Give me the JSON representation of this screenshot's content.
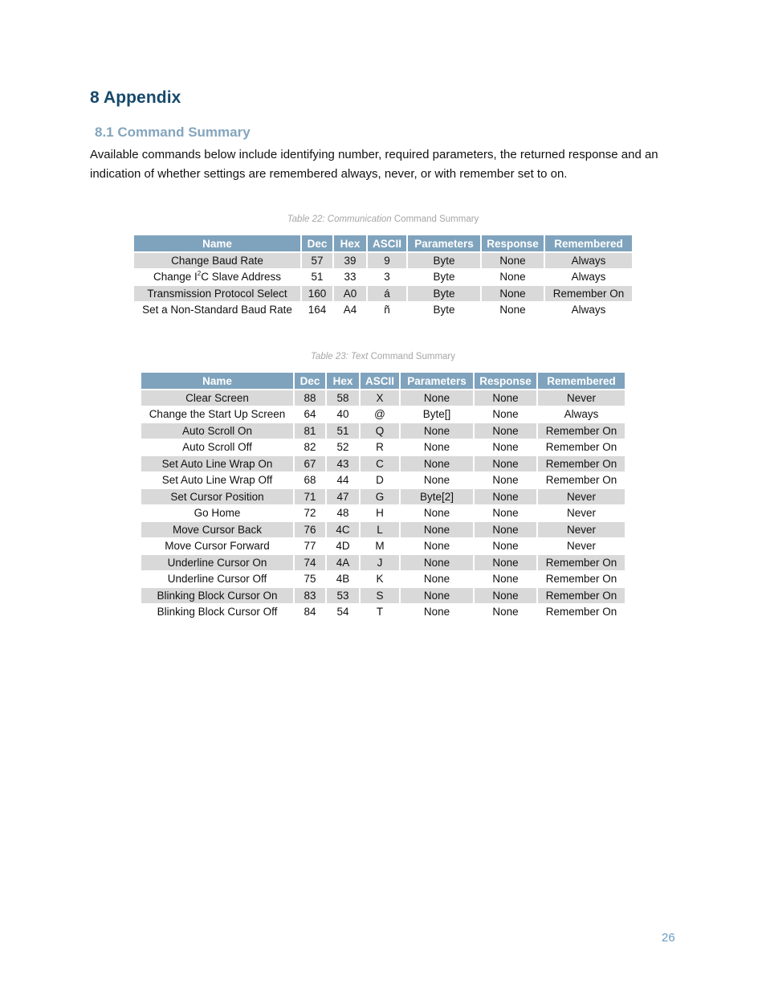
{
  "heading": "8 Appendix",
  "subheading": "8.1 Command Summary",
  "intro": "Available commands below include identifying number, required parameters, the returned response and an indication of whether settings are remembered always, never, or with remember set to on.",
  "colors": {
    "heading": "#17496a",
    "subheading": "#84a5bd",
    "table_header_bg": "#7fa3bd",
    "row_shade": "#d9d9d9",
    "page_number": "#6c9bbf"
  },
  "tables": [
    {
      "caption_italic": "Table 22: Communication",
      "caption_rest": " Command Summary",
      "columns": [
        "Name",
        "Dec",
        "Hex",
        "ASCII",
        "Parameters",
        "Response",
        "Remembered"
      ],
      "rows": [
        {
          "name": "Change Baud Rate",
          "dec": "57",
          "hex": "39",
          "ascii": "9",
          "params": "Byte",
          "response": "None",
          "remembered": "Always"
        },
        {
          "name_pre": "Change I",
          "name_sup": "2",
          "name_post": "C Slave Address",
          "dec": "51",
          "hex": "33",
          "ascii": "3",
          "params": "Byte",
          "response": "None",
          "remembered": "Always"
        },
        {
          "name": "Transmission Protocol Select",
          "dec": "160",
          "hex": "A0",
          "ascii": "á",
          "params": "Byte",
          "response": "None",
          "remembered": "Remember On"
        },
        {
          "name": "Set a Non-Standard Baud Rate",
          "dec": "164",
          "hex": "A4",
          "ascii": "ñ",
          "params": "Byte",
          "response": "None",
          "remembered": "Always"
        }
      ]
    },
    {
      "caption_italic": "Table 23: Text",
      "caption_rest": " Command Summary",
      "columns": [
        "Name",
        "Dec",
        "Hex",
        "ASCII",
        "Parameters",
        "Response",
        "Remembered"
      ],
      "rows": [
        {
          "name": "Clear Screen",
          "dec": "88",
          "hex": "58",
          "ascii": "X",
          "params": "None",
          "response": "None",
          "remembered": "Never"
        },
        {
          "name": "Change the Start Up Screen",
          "dec": "64",
          "hex": "40",
          "ascii": "@",
          "params": "Byte[]",
          "response": "None",
          "remembered": "Always"
        },
        {
          "name": "Auto Scroll On",
          "dec": "81",
          "hex": "51",
          "ascii": "Q",
          "params": "None",
          "response": "None",
          "remembered": "Remember On"
        },
        {
          "name": "Auto Scroll Off",
          "dec": "82",
          "hex": "52",
          "ascii": "R",
          "params": "None",
          "response": "None",
          "remembered": "Remember On"
        },
        {
          "name": "Set Auto Line Wrap On",
          "dec": "67",
          "hex": "43",
          "ascii": "C",
          "params": "None",
          "response": "None",
          "remembered": "Remember On"
        },
        {
          "name": "Set Auto Line Wrap Off",
          "dec": "68",
          "hex": "44",
          "ascii": "D",
          "params": "None",
          "response": "None",
          "remembered": "Remember On"
        },
        {
          "name": "Set Cursor Position",
          "dec": "71",
          "hex": "47",
          "ascii": "G",
          "params": "Byte[2]",
          "response": "None",
          "remembered": "Never"
        },
        {
          "name": "Go Home",
          "dec": "72",
          "hex": "48",
          "ascii": "H",
          "params": "None",
          "response": "None",
          "remembered": "Never"
        },
        {
          "name": "Move Cursor Back",
          "dec": "76",
          "hex": "4C",
          "ascii": "L",
          "params": "None",
          "response": "None",
          "remembered": "Never"
        },
        {
          "name": "Move Cursor Forward",
          "dec": "77",
          "hex": "4D",
          "ascii": "M",
          "params": "None",
          "response": "None",
          "remembered": "Never"
        },
        {
          "name": "Underline Cursor On",
          "dec": "74",
          "hex": "4A",
          "ascii": "J",
          "params": "None",
          "response": "None",
          "remembered": "Remember On"
        },
        {
          "name": "Underline Cursor Off",
          "dec": "75",
          "hex": "4B",
          "ascii": "K",
          "params": "None",
          "response": "None",
          "remembered": "Remember On"
        },
        {
          "name": "Blinking Block Cursor On",
          "dec": "83",
          "hex": "53",
          "ascii": "S",
          "params": "None",
          "response": "None",
          "remembered": "Remember On"
        },
        {
          "name": "Blinking Block Cursor Off",
          "dec": "84",
          "hex": "54",
          "ascii": "T",
          "params": "None",
          "response": "None",
          "remembered": "Remember On"
        }
      ]
    }
  ],
  "page_number": "26"
}
